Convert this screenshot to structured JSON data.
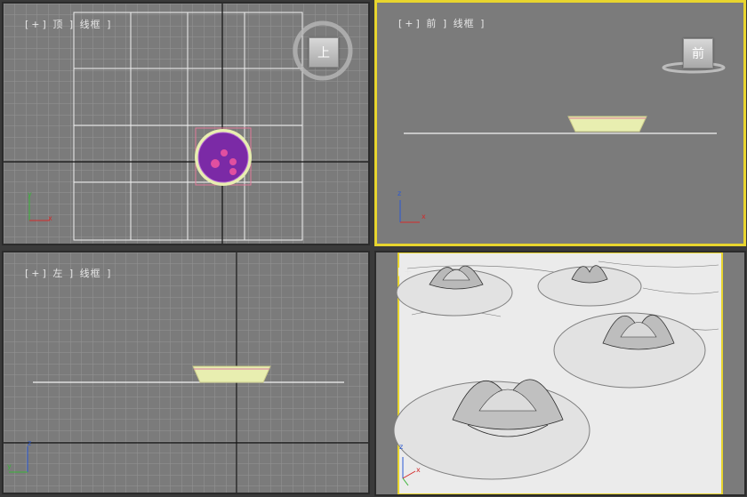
{
  "viewports": {
    "top": {
      "label_parts": [
        "[",
        "+",
        "]",
        "顶",
        "]",
        "线框",
        "]"
      ],
      "viewcube": "上"
    },
    "front": {
      "label_parts": [
        "[",
        "+",
        "]",
        "前",
        "]",
        "线框",
        "]"
      ],
      "viewcube": "前"
    },
    "left": {
      "label_parts": [
        "[",
        "+",
        "]",
        "左",
        "]",
        "线框",
        "]"
      ]
    },
    "perspective": {
      "label_parts": [
        "[",
        "+"
      ]
    }
  },
  "axes": {
    "top": {
      "x": "x",
      "y": "y"
    },
    "front": {
      "x": "x",
      "z": "z"
    },
    "left": {
      "y": "y",
      "z": "z"
    },
    "perspective": {
      "x": "x",
      "z": "z"
    }
  },
  "colors": {
    "active_border": "#e8d52e",
    "grid": "#9a9a9a",
    "grid_major": "#d8d8d8",
    "object": "#e8eeb0",
    "selected": "#7b2aa6"
  }
}
